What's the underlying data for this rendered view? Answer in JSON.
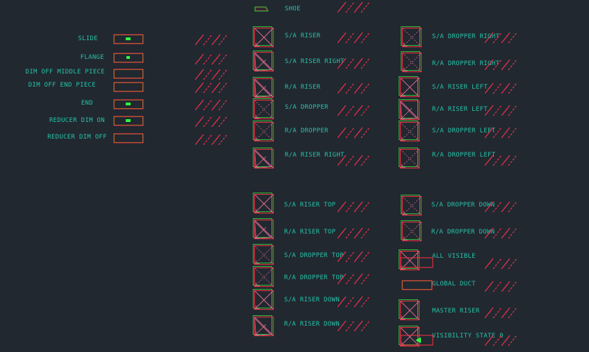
{
  "colors": {
    "background": "#212830",
    "text": "#27c2a8",
    "red": "#e0303f",
    "green": "#2ec23a",
    "hatch": "#e8304a",
    "bright_green": "#30ff40",
    "dashed_pink": "#d96a8c"
  },
  "left_column": [
    {
      "label": "SLIDE",
      "symbol": "slide-block"
    },
    {
      "label": "FLANGE",
      "symbol": "flange-block"
    },
    {
      "label": "DIM OFF MIDDLE PIECE",
      "symbol": "dim-off-middle-block"
    },
    {
      "label": "DIM OFF END PIECE",
      "symbol": "dim-off-end-block"
    },
    {
      "label": "END",
      "symbol": "end-block"
    },
    {
      "label": "REDUCER DIM ON",
      "symbol": "reducer-dim-on-block"
    },
    {
      "label": "REDUCER DIM OFF",
      "symbol": "reducer-dim-off-block"
    }
  ],
  "middle_column": [
    {
      "label": "SHOE"
    },
    {
      "label": "S/A RISER"
    },
    {
      "label": "S/A RISER RIGHT"
    },
    {
      "label": "R/A RISER"
    },
    {
      "label": "S/A DROPPER"
    },
    {
      "label": "R/A DROPPER"
    },
    {
      "label": "R/A RISER RIGHT"
    },
    {
      "label": "S/A RISER TOP"
    },
    {
      "label": "R/A RISER TOP"
    },
    {
      "label": "S/A DROPPER TOP"
    },
    {
      "label": "R/A DROPPER TOP"
    },
    {
      "label": "S/A RISER DOWN"
    },
    {
      "label": "R/A RISER DOWN"
    }
  ],
  "right_column": [
    {
      "label": "S/A DROPPER RIGHT"
    },
    {
      "label": "R/A DROPPER RIGHT"
    },
    {
      "label": "S/A RISER LEFT"
    },
    {
      "label": "R/A RISER LEFT"
    },
    {
      "label": "S/A DROPPER LEFT"
    },
    {
      "label": "R/A DROPPER LEFT"
    },
    {
      "label": "S/A DROPPER DOWN"
    },
    {
      "label": "R/A DROPPER DOWN"
    },
    {
      "label": "ALL VISIBLE"
    },
    {
      "label": "GLOBAL DUCT"
    },
    {
      "label": "MASTER RISER"
    },
    {
      "label": "VISIBILITY STATE 0"
    }
  ]
}
